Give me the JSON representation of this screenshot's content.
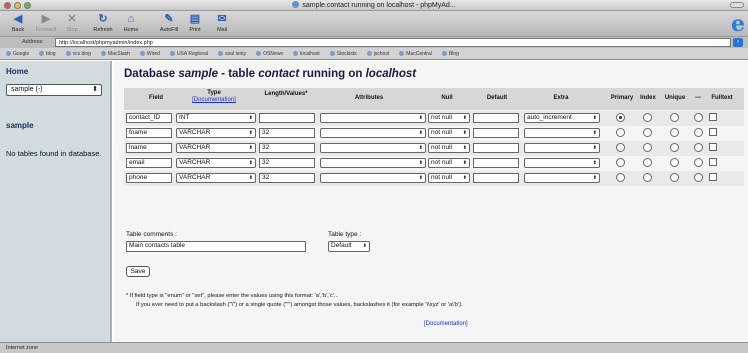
{
  "window": {
    "title": "sample.contact running on localhost - phpMyAd..."
  },
  "toolbar": {
    "buttons": [
      {
        "label": "Back",
        "icon": "back-arrow-icon",
        "glyph": "◀",
        "enabled": true
      },
      {
        "label": "Forward",
        "icon": "forward-arrow-icon",
        "glyph": "▶",
        "enabled": false
      },
      {
        "label": "Stop",
        "icon": "stop-icon",
        "glyph": "✕",
        "enabled": false
      },
      {
        "label": "Refresh",
        "icon": "refresh-icon",
        "glyph": "↻",
        "enabled": true
      },
      {
        "label": "Home",
        "icon": "home-icon",
        "glyph": "⌂",
        "enabled": true
      },
      {
        "label": "AutoFill",
        "icon": "autofill-pen-icon",
        "glyph": "✎",
        "enabled": true
      },
      {
        "label": "Print",
        "icon": "printer-icon",
        "glyph": "▤",
        "enabled": true
      },
      {
        "label": "Mail",
        "icon": "mail-icon",
        "glyph": "✉",
        "enabled": true
      }
    ],
    "brand_glyph": "e"
  },
  "address": {
    "label": "Address:",
    "url": "http://localhost/phpmyadmin/index.php",
    "go_glyph": "›"
  },
  "favorites": [
    "Google",
    "blog",
    "vcs blog",
    "MacSlash",
    "Wired",
    "USA Regional",
    "soul lenty",
    "OSNews",
    "localhost",
    "Stockists",
    "jschool",
    "MacCentral",
    "Blog"
  ],
  "left": {
    "home": "Home",
    "db_select": "sample (-)",
    "db_name": "sample",
    "no_tables": "No tables found in database."
  },
  "main": {
    "heading_pre": "Database ",
    "heading_db": "sample",
    "heading_mid": " - table ",
    "heading_table": "contact",
    "heading_mid2": " running on ",
    "heading_host": "localhost",
    "headers": {
      "field": "Field",
      "type": "Type",
      "type_doc": "[Documentation]",
      "length": "Length/Values*",
      "attributes": "Attributes",
      "null": "Null",
      "default": "Default",
      "extra": "Extra",
      "primary": "Primary",
      "index": "Index",
      "unique": "Unique",
      "dash": "---",
      "fulltext": "Fulltext"
    },
    "rows": [
      {
        "field": "contact_ID",
        "type": "INT",
        "length": "",
        "attributes": "",
        "null": "not null",
        "default": "",
        "extra": "auto_increment",
        "primary": true
      },
      {
        "field": "fname",
        "type": "VARCHAR",
        "length": "32",
        "attributes": "",
        "null": "not null",
        "default": "",
        "extra": "",
        "primary": false
      },
      {
        "field": "lname",
        "type": "VARCHAR",
        "length": "32",
        "attributes": "",
        "null": "not null",
        "default": "",
        "extra": "",
        "primary": false
      },
      {
        "field": "email",
        "type": "VARCHAR",
        "length": "32",
        "attributes": "",
        "null": "not null",
        "default": "",
        "extra": "",
        "primary": false
      },
      {
        "field": "phone",
        "type": "VARCHAR",
        "length": "32",
        "attributes": "",
        "null": "not null",
        "default": "",
        "extra": "",
        "primary": false
      }
    ],
    "table_comments_label": "Table comments :",
    "table_comments_value": "Main contacts table",
    "table_type_label": "Table type :",
    "table_type_value": "Default",
    "save": "Save",
    "note1": "*  If field type is \"enum\" or \"set\", please enter the values using this format: 'a','b','c'...",
    "note2": "If you ever need to put a backslash (\"\\\") or a single quote (\"'\") amongst those values, backslashes it (for example '\\\\xyz' or 'a\\'b').",
    "documentation": "[Documentation]"
  },
  "status": {
    "text": "Internet zone"
  },
  "colors": {
    "left_bg": "#d0dce0",
    "header_bg": "#d7d7d7",
    "row_even": "#e9e9e9",
    "row_odd": "#f5f5f5",
    "heading": "#1a1a40",
    "link": "#1a2fbf"
  }
}
